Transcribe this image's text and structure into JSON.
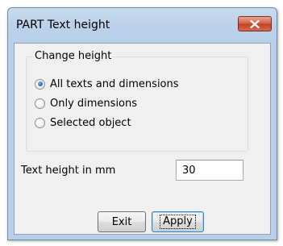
{
  "window": {
    "title": "PART Text height",
    "close_icon": "close-icon",
    "close_color": "#c7452c"
  },
  "group": {
    "label": "Change height",
    "options": [
      {
        "label": "All texts and dimensions",
        "selected": true
      },
      {
        "label": "Only dimensions",
        "selected": false
      },
      {
        "label": "Selected object",
        "selected": false
      }
    ]
  },
  "text_height": {
    "label": "Text height in mm",
    "value": "30"
  },
  "buttons": {
    "exit_label": "Exit",
    "apply_label": "Apply"
  }
}
